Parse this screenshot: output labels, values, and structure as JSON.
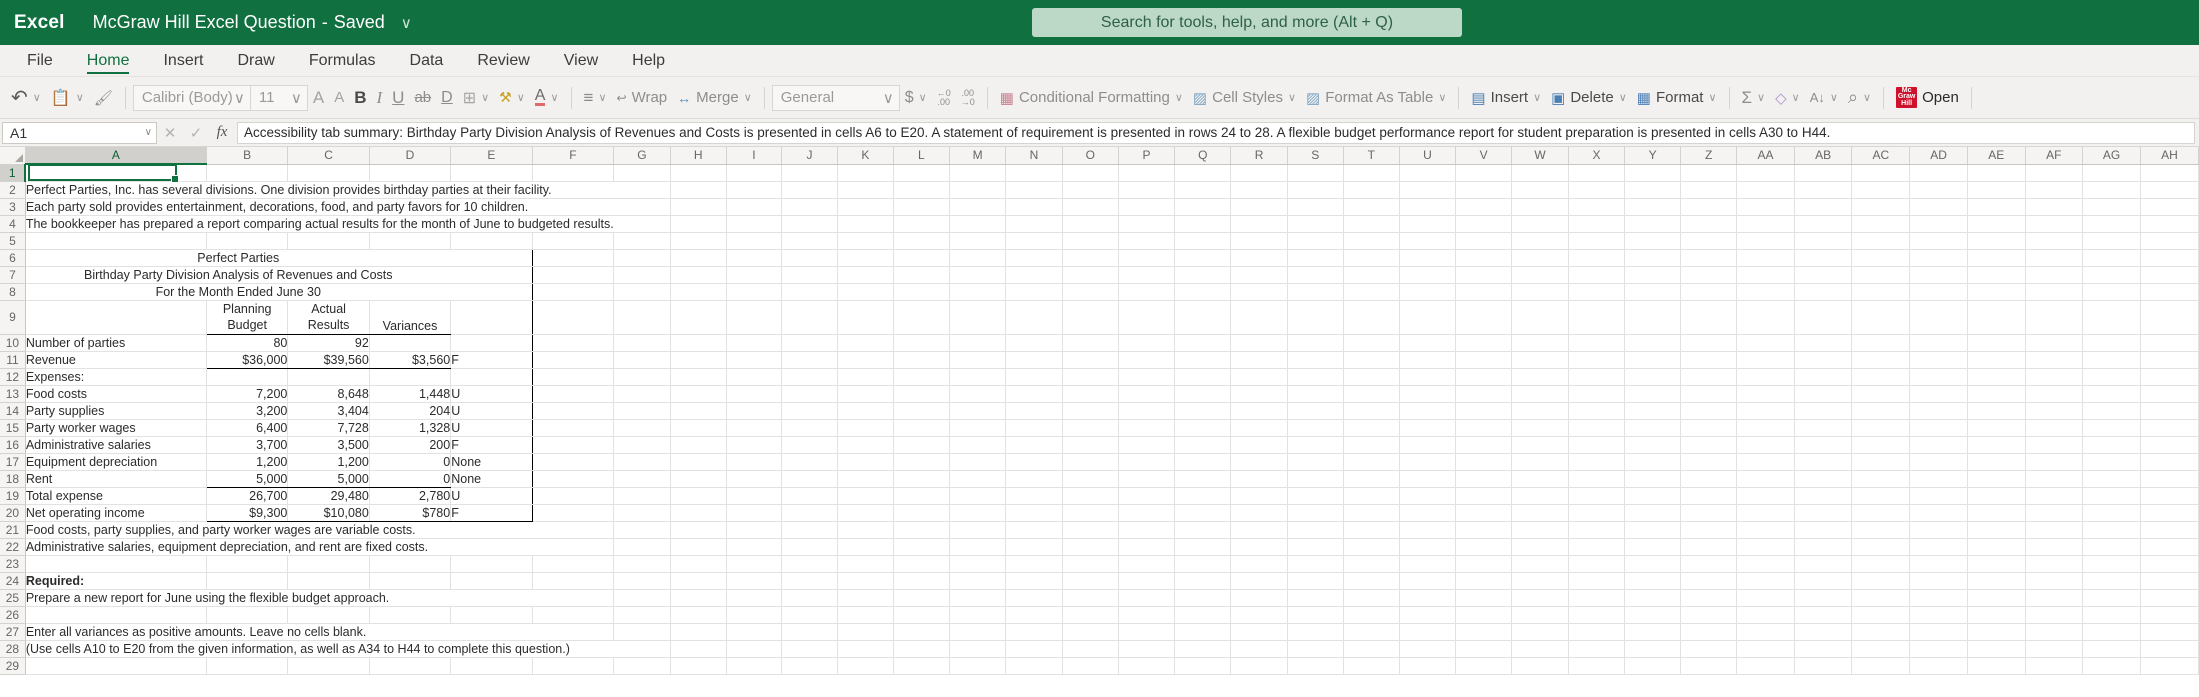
{
  "titlebar": {
    "app_name": "Excel",
    "document_title": "McGraw Hill Excel Question",
    "dash": "-",
    "saved_status": "Saved",
    "chevron": "∨",
    "search_placeholder": "Search for tools, help, and more (Alt + Q)"
  },
  "menu": {
    "items": [
      "File",
      "Home",
      "Insert",
      "Draw",
      "Formulas",
      "Data",
      "Review",
      "View",
      "Help"
    ],
    "active": "Home"
  },
  "ribbon": {
    "undo_label": "↶",
    "paste_label": "📋",
    "format_painter_label": "🖌",
    "font_name": "Calibri (Body)",
    "font_size": "11",
    "grow_font": "A",
    "shrink_font": "A",
    "bold": "B",
    "italic": "I",
    "underline": "U",
    "strikethrough": "ab",
    "borders_label": "⊞",
    "fill_color_label": "⬛",
    "font_color_label": "A",
    "align_label": "≡",
    "wrap_label": "Wrap",
    "merge_label": "Merge",
    "number_format": "General",
    "currency_label": "$",
    "decrease_decimal": "←0\n.00",
    "increase_decimal": ".00\n→0",
    "conditional_formatting": "Conditional Formatting",
    "cell_styles": "Cell Styles",
    "format_as_table": "Format As Table",
    "insert_label": "Insert",
    "delete_label": "Delete",
    "format_label": "Format",
    "autosum_label": "Σ",
    "clear_label": "◇",
    "sort_filter_label": "A↓",
    "find_label": "⌕",
    "mcgraw_line1": "Mc",
    "mcgraw_line2": "Graw",
    "mcgraw_line3": "Hill",
    "open_label": "Open",
    "chevron": "∨"
  },
  "formulabar": {
    "name_box": "A1",
    "cancel": "✕",
    "confirm": "✓",
    "fx": "fx",
    "content": "Accessibility tab summary: Birthday Party Division Analysis of Revenues and Costs is presented in cells A6 to E20. A statement of requirement is presented in rows 24 to 28. A flexible budget performance report for student preparation is presented in cells A30 to H44."
  },
  "grid": {
    "columns": [
      "A",
      "B",
      "C",
      "D",
      "E",
      "F",
      "G",
      "H",
      "I",
      "J",
      "K",
      "L",
      "M",
      "N",
      "O",
      "P",
      "Q",
      "R",
      "S",
      "T",
      "U",
      "V",
      "W",
      "X",
      "Y",
      "Z",
      "AA",
      "AB",
      "AC",
      "AD",
      "AE",
      "AF",
      "AG",
      "AH"
    ],
    "selected_column": "A",
    "selected_row": 1,
    "row_numbers": [
      1,
      2,
      3,
      4,
      5,
      6,
      7,
      8,
      9,
      10,
      11,
      12,
      13,
      14,
      15,
      16,
      17,
      18,
      19,
      20,
      21,
      22,
      23,
      24,
      25,
      26,
      27,
      28,
      29
    ],
    "cells": {
      "A2": "Perfect Parties, Inc. has several divisions.  One division provides birthday parties at their facility.",
      "A3": "Each party sold provides entertainment, decorations, food, and party favors for 10 children.",
      "A4": "The bookkeeper has prepared a report comparing actual results for the month of June to budgeted results.",
      "A6": "Perfect Parties",
      "A7": "Birthday Party Division Analysis of Revenues and Costs",
      "A8": "For the Month Ended June 30",
      "B9": "Planning\nBudget",
      "C9": "Actual\nResults",
      "D9": "Variances",
      "A10": "Number of parties",
      "B10": "80",
      "C10": "92",
      "A11": "Revenue",
      "B11": "$36,000",
      "C11": "$39,560",
      "D11": "$3,560",
      "E11": "F",
      "A12": "Expenses:",
      "A13": "Food costs",
      "B13": "7,200",
      "C13": "8,648",
      "D13": "1,448",
      "E13": "U",
      "A14": "Party supplies",
      "B14": "3,200",
      "C14": "3,404",
      "D14": "204",
      "E14": "U",
      "A15": "Party worker wages",
      "B15": "6,400",
      "C15": "7,728",
      "D15": "1,328",
      "E15": "U",
      "A16": "Administrative salaries",
      "B16": "3,700",
      "C16": "3,500",
      "D16": "200",
      "E16": "F",
      "A17": "Equipment depreciation",
      "B17": "1,200",
      "C17": "1,200",
      "D17": "0",
      "E17": "None",
      "A18": "Rent",
      "B18": "5,000",
      "C18": "5,000",
      "D18": "0",
      "E18": "None",
      "A19": "Total expense",
      "B19": "26,700",
      "C19": "29,480",
      "D19": "2,780",
      "E19": "U",
      "A20": "Net operating income",
      "B20": "$9,300",
      "C20": "$10,080",
      "D20": "$780",
      "E20": "F",
      "A21": "Food costs, party supplies, and party worker wages are variable costs.",
      "A22": "Administrative salaries, equipment depreciation, and rent are fixed costs.",
      "A24": "Required:",
      "A25": "Prepare a new report for June using the flexible budget approach.",
      "A27": "Enter all variances as positive amounts.  Leave no cells blank.",
      "A28": "(Use cells A10 to E20 from the given information, as well as A34 to H44 to complete this question.)"
    }
  },
  "colors": {
    "brand_green": "#107040",
    "ribbon_bg": "#f2f1ef",
    "red_text": "#c00000",
    "mcgraw_red": "#d0112b"
  }
}
